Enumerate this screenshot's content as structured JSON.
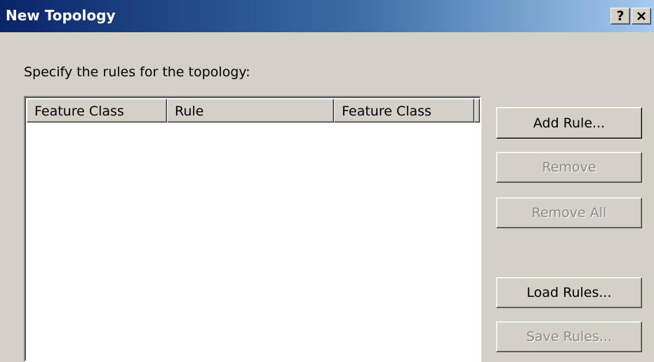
{
  "window": {
    "title": "New Topology",
    "help_label": "?",
    "close_icon": "close-icon"
  },
  "prompt": "Specify the rules for the topology:",
  "rules_table": {
    "columns": [
      "Feature Class",
      "Rule",
      "Feature Class"
    ],
    "rows": []
  },
  "buttons": {
    "add_rule": "Add Rule...",
    "remove": "Remove",
    "remove_all": "Remove All",
    "load_rules": "Load Rules...",
    "save_rules": "Save Rules..."
  },
  "colors": {
    "title_gradient_start": "#0a246a",
    "title_gradient_end": "#a6caf0",
    "face": "#d4d0c8",
    "disabled_text": "#8a8a8a"
  }
}
